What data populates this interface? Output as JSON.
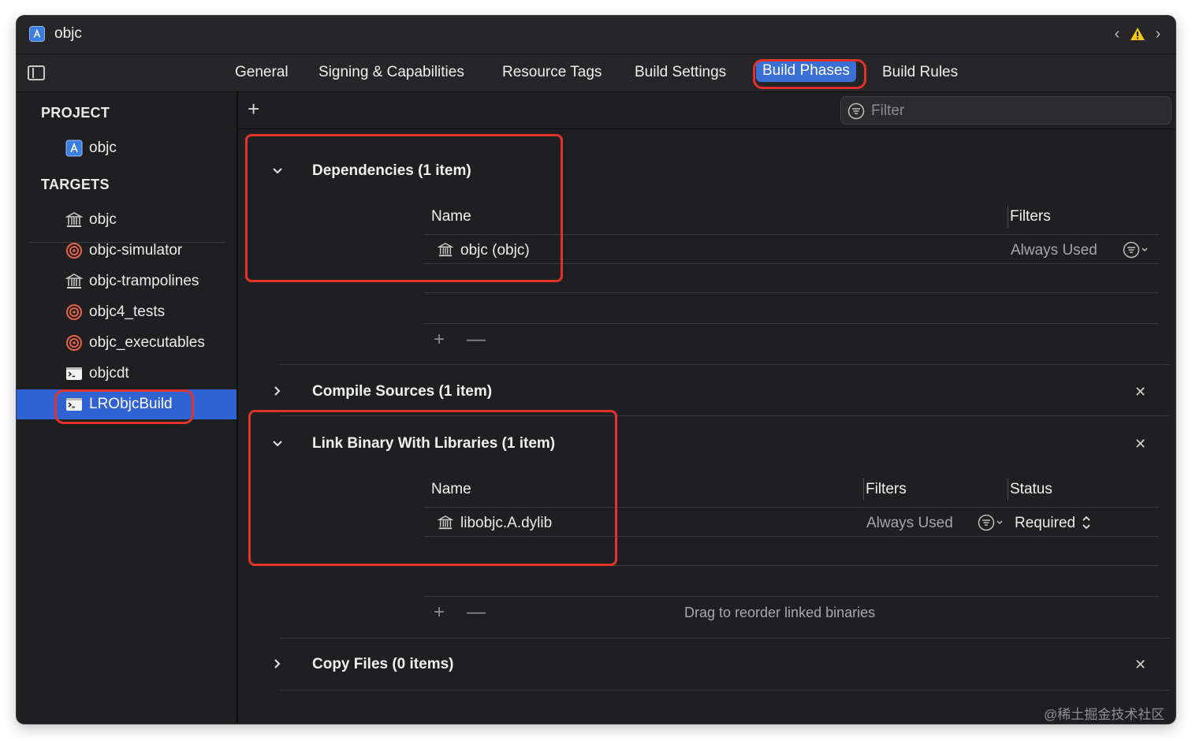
{
  "window": {
    "title": "objc",
    "icons": {
      "app": "xcode-project-icon",
      "back": "chevron-left-icon",
      "warning": "warning-icon",
      "forward": "chevron-right-icon"
    }
  },
  "tabs": [
    {
      "label": "General"
    },
    {
      "label": "Signing & Capabilities"
    },
    {
      "label": "Resource Tags"
    },
    {
      "label": "Build Settings"
    },
    {
      "label": "Build Phases",
      "selected": true
    },
    {
      "label": "Build Rules"
    }
  ],
  "sidebar": {
    "project_header": "PROJECT",
    "project_item": {
      "label": "objc",
      "icon": "xcode-project-icon"
    },
    "targets_header": "TARGETS",
    "targets": [
      {
        "label": "objc",
        "icon": "library-icon"
      },
      {
        "label": "objc-simulator",
        "icon": "target-icon"
      },
      {
        "label": "objc-trampolines",
        "icon": "library-icon"
      },
      {
        "label": "objc4_tests",
        "icon": "target-icon"
      },
      {
        "label": "objc_executables",
        "icon": "target-icon"
      },
      {
        "label": "objcdt",
        "icon": "terminal-icon"
      },
      {
        "label": "LRObjcBuild",
        "icon": "terminal-icon",
        "selected": true
      }
    ]
  },
  "toolbar": {
    "add_label": "+",
    "filter_placeholder": "Filter"
  },
  "phases": {
    "dependencies": {
      "title": "Dependencies (1 item)",
      "expanded": true,
      "columns": {
        "name": "Name",
        "filters": "Filters"
      },
      "rows": [
        {
          "name": "objc (objc)",
          "filters": "Always Used"
        }
      ],
      "add": "+",
      "remove": "—"
    },
    "compile_sources": {
      "title": "Compile Sources (1 item)",
      "expanded": false,
      "close": "✕"
    },
    "link_binary": {
      "title": "Link Binary With Libraries (1 item)",
      "expanded": true,
      "close": "✕",
      "columns": {
        "name": "Name",
        "filters": "Filters",
        "status": "Status"
      },
      "rows": [
        {
          "name": "libobjc.A.dylib",
          "filters": "Always Used",
          "status": "Required"
        }
      ],
      "add": "+",
      "remove": "—",
      "hint": "Drag to reorder linked binaries"
    },
    "copy_files": {
      "title": "Copy Files (0 items)",
      "expanded": false,
      "close": "✕"
    }
  },
  "watermark": "@稀土掘金技术社区",
  "colors": {
    "accent": "#2f62d3",
    "highlight_box": "#e2332a",
    "background": "#1f1f21"
  }
}
